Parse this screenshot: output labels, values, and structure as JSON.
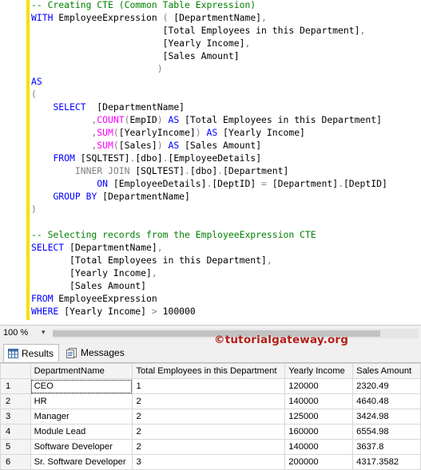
{
  "editor": {
    "lines": [
      [
        {
          "t": "-- Creating CTE (Common Table Expression)",
          "c": "cm"
        }
      ],
      [
        {
          "t": "WITH",
          "c": "kw"
        },
        {
          "t": " EmployeeExpression ",
          "c": "id"
        },
        {
          "t": "(",
          "c": "op"
        },
        {
          "t": " [DepartmentName]",
          "c": "id"
        },
        {
          "t": ",",
          "c": "op"
        }
      ],
      [
        {
          "t": "                        [Total Employees in this Department]",
          "c": "id"
        },
        {
          "t": ",",
          "c": "op"
        }
      ],
      [
        {
          "t": "                        [Yearly Income]",
          "c": "id"
        },
        {
          "t": ",",
          "c": "op"
        }
      ],
      [
        {
          "t": "                        [Sales Amount]",
          "c": "id"
        }
      ],
      [
        {
          "t": "                       )",
          "c": "op"
        }
      ],
      [
        {
          "t": "AS",
          "c": "kw"
        }
      ],
      [
        {
          "t": "(",
          "c": "op"
        }
      ],
      [
        {
          "t": "    ",
          "c": "id"
        },
        {
          "t": "SELECT",
          "c": "kw"
        },
        {
          "t": "  [DepartmentName]",
          "c": "id"
        }
      ],
      [
        {
          "t": "           ",
          "c": "id"
        },
        {
          "t": ",",
          "c": "op"
        },
        {
          "t": "COUNT",
          "c": "fn"
        },
        {
          "t": "(",
          "c": "op"
        },
        {
          "t": "EmpID",
          "c": "id"
        },
        {
          "t": ")",
          "c": "op"
        },
        {
          "t": " AS",
          "c": "kw"
        },
        {
          "t": " [Total Employees in this Department]",
          "c": "id"
        }
      ],
      [
        {
          "t": "           ",
          "c": "id"
        },
        {
          "t": ",",
          "c": "op"
        },
        {
          "t": "SUM",
          "c": "fn"
        },
        {
          "t": "(",
          "c": "op"
        },
        {
          "t": "[YearlyIncome]",
          "c": "id"
        },
        {
          "t": ")",
          "c": "op"
        },
        {
          "t": " AS",
          "c": "kw"
        },
        {
          "t": " [Yearly Income]",
          "c": "id"
        }
      ],
      [
        {
          "t": "           ",
          "c": "id"
        },
        {
          "t": ",",
          "c": "op"
        },
        {
          "t": "SUM",
          "c": "fn"
        },
        {
          "t": "(",
          "c": "op"
        },
        {
          "t": "[Sales]",
          "c": "id"
        },
        {
          "t": ")",
          "c": "op"
        },
        {
          "t": " AS",
          "c": "kw"
        },
        {
          "t": " [Sales Amount]",
          "c": "id"
        }
      ],
      [
        {
          "t": "    ",
          "c": "id"
        },
        {
          "t": "FROM",
          "c": "kw"
        },
        {
          "t": " [SQLTEST]",
          "c": "id"
        },
        {
          "t": ".",
          "c": "op"
        },
        {
          "t": "[dbo]",
          "c": "id"
        },
        {
          "t": ".",
          "c": "op"
        },
        {
          "t": "[EmployeeDetails]",
          "c": "id"
        }
      ],
      [
        {
          "t": "        ",
          "c": "id"
        },
        {
          "t": "INNER JOIN",
          "c": "op"
        },
        {
          "t": " [SQLTEST]",
          "c": "id"
        },
        {
          "t": ".",
          "c": "op"
        },
        {
          "t": "[dbo]",
          "c": "id"
        },
        {
          "t": ".",
          "c": "op"
        },
        {
          "t": "[Department]",
          "c": "id"
        }
      ],
      [
        {
          "t": "            ",
          "c": "id"
        },
        {
          "t": "ON",
          "c": "kw"
        },
        {
          "t": " [EmployeeDetails]",
          "c": "id"
        },
        {
          "t": ".",
          "c": "op"
        },
        {
          "t": "[DeptID]",
          "c": "id"
        },
        {
          "t": " = ",
          "c": "op"
        },
        {
          "t": "[Department]",
          "c": "id"
        },
        {
          "t": ".",
          "c": "op"
        },
        {
          "t": "[DeptID]",
          "c": "id"
        }
      ],
      [
        {
          "t": "    ",
          "c": "id"
        },
        {
          "t": "GROUP BY",
          "c": "kw"
        },
        {
          "t": " [DepartmentName]",
          "c": "id"
        }
      ],
      [
        {
          "t": ")",
          "c": "op"
        }
      ],
      [
        {
          "t": "",
          "c": "id"
        }
      ],
      [
        {
          "t": "-- Selecting records from the EmployeeExpression CTE",
          "c": "cm"
        }
      ],
      [
        {
          "t": "SELECT",
          "c": "kw"
        },
        {
          "t": " [DepartmentName]",
          "c": "id"
        },
        {
          "t": ",",
          "c": "op"
        }
      ],
      [
        {
          "t": "       [Total Employees in this Department]",
          "c": "id"
        },
        {
          "t": ",",
          "c": "op"
        }
      ],
      [
        {
          "t": "       [Yearly Income]",
          "c": "id"
        },
        {
          "t": ",",
          "c": "op"
        }
      ],
      [
        {
          "t": "       [Sales Amount]",
          "c": "id"
        }
      ],
      [
        {
          "t": "FROM",
          "c": "kw"
        },
        {
          "t": " EmployeeExpression",
          "c": "id"
        }
      ],
      [
        {
          "t": "WHERE",
          "c": "kw"
        },
        {
          "t": " [Yearly Income] ",
          "c": "id"
        },
        {
          "t": ">",
          "c": "op"
        },
        {
          "t": " 100000",
          "c": "num"
        }
      ]
    ]
  },
  "zoom": {
    "value": "100 %",
    "arrow": "▾"
  },
  "watermark": "©tutorialgateway.org",
  "tabs": {
    "results_label": "Results",
    "messages_label": "Messages"
  },
  "grid": {
    "columns": [
      "DepartmentName",
      "Total Employees in this Department",
      "Yearly Income",
      "Sales Amount"
    ],
    "rows": [
      {
        "num": "1",
        "cells": [
          "CEO",
          "1",
          "120000",
          "2320.49"
        ]
      },
      {
        "num": "2",
        "cells": [
          "HR",
          "2",
          "140000",
          "4640.48"
        ]
      },
      {
        "num": "3",
        "cells": [
          "Manager",
          "2",
          "125000",
          "3424.98"
        ]
      },
      {
        "num": "4",
        "cells": [
          "Module Lead",
          "2",
          "160000",
          "6554.98"
        ]
      },
      {
        "num": "5",
        "cells": [
          "Software Developer",
          "2",
          "140000",
          "3637.8"
        ]
      },
      {
        "num": "6",
        "cells": [
          "Sr. Software Developer",
          "3",
          "200000",
          "4317.3582"
        ]
      }
    ]
  },
  "colors": {
    "keyword": "#0000ff",
    "comment": "#008000",
    "function": "#ff00ff",
    "operator": "#808080",
    "change_bar": "#f2e200",
    "watermark": "#b32018"
  }
}
